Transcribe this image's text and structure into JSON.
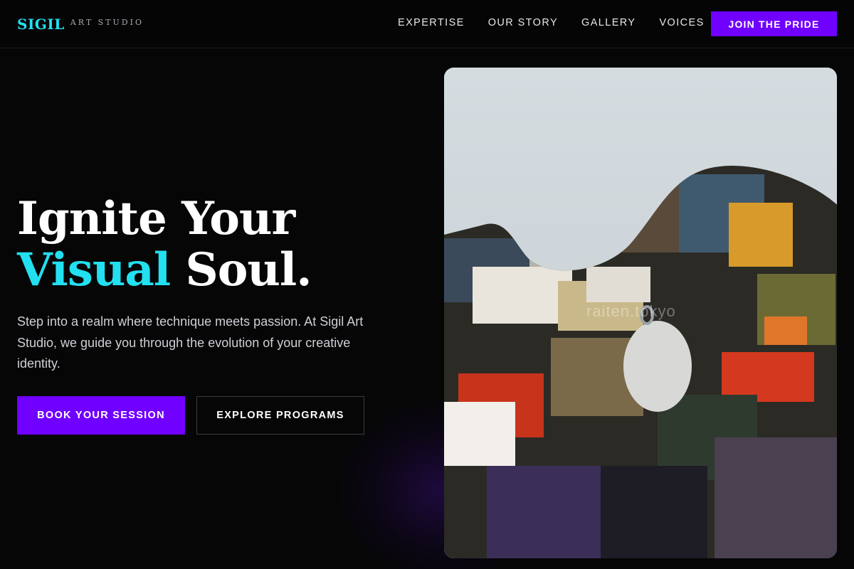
{
  "brand": {
    "name": "SIGIL",
    "tagline": "ART STUDIO",
    "accent_color": "#22e0f0",
    "primary_color": "#7000ff"
  },
  "nav": {
    "links": [
      "EXPERTISE",
      "OUR STORY",
      "GALLERY",
      "VOICES"
    ],
    "cta_label": "JOIN THE PRIDE"
  },
  "hero": {
    "title_line1": "Ignite Your",
    "title_accent": "Visual",
    "title_line2_rest": " Soul.",
    "description": "Step into a realm where technique meets passion. At Sigil Art Studio, we guide you through the evolution of your creative identity.",
    "primary_button": "BOOK YOUR SESSION",
    "secondary_button": "EXPLORE PROGRAMS",
    "image": {
      "subject": "paint-palette-photo",
      "watermark": "raiten.tokyo"
    }
  }
}
